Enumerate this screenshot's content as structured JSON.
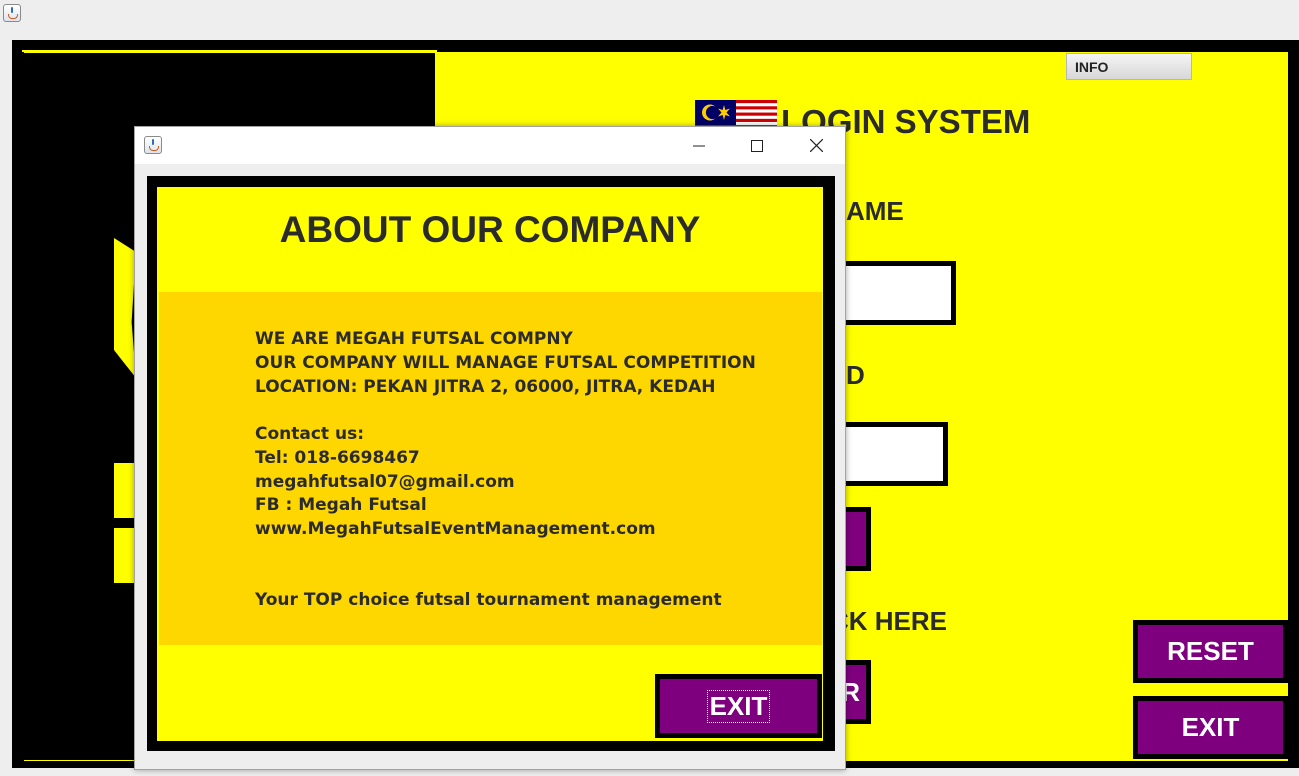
{
  "main_window": {
    "info_button": "INFO",
    "title": "LOGIN SYSTEM",
    "username_label_visible": "AME",
    "password_label_visible": "D",
    "register_prompt_visible": "CK HERE",
    "register_button_visible": "R",
    "reset_button": "RESET",
    "exit_button": "EXIT"
  },
  "dialog": {
    "heading": "ABOUT OUR COMPANY",
    "lines": [
      "WE ARE MEGAH FUTSAL COMPNY",
      "OUR COMPANY WILL MANAGE FUTSAL COMPETITION",
      "LOCATION: PEKAN JITRA 2, 06000, JITRA, KEDAH",
      "Contact us:",
      "Tel: 018-6698467",
      "megahfutsal07@gmail.com",
      "FB : Megah Futsal",
      "www.MegahFutsalEventManagement.com",
      "Your TOP choice futsal tournament management"
    ],
    "exit_button": "EXIT"
  },
  "colors": {
    "background_yellow": "#ffff00",
    "panel_gold": "#ffd700",
    "button_purple": "#7f007f",
    "frame_black": "#000000"
  },
  "icons": [
    "java-app-icon",
    "malaysia-flag-icon",
    "minimize-icon",
    "maximize-icon",
    "close-icon"
  ]
}
